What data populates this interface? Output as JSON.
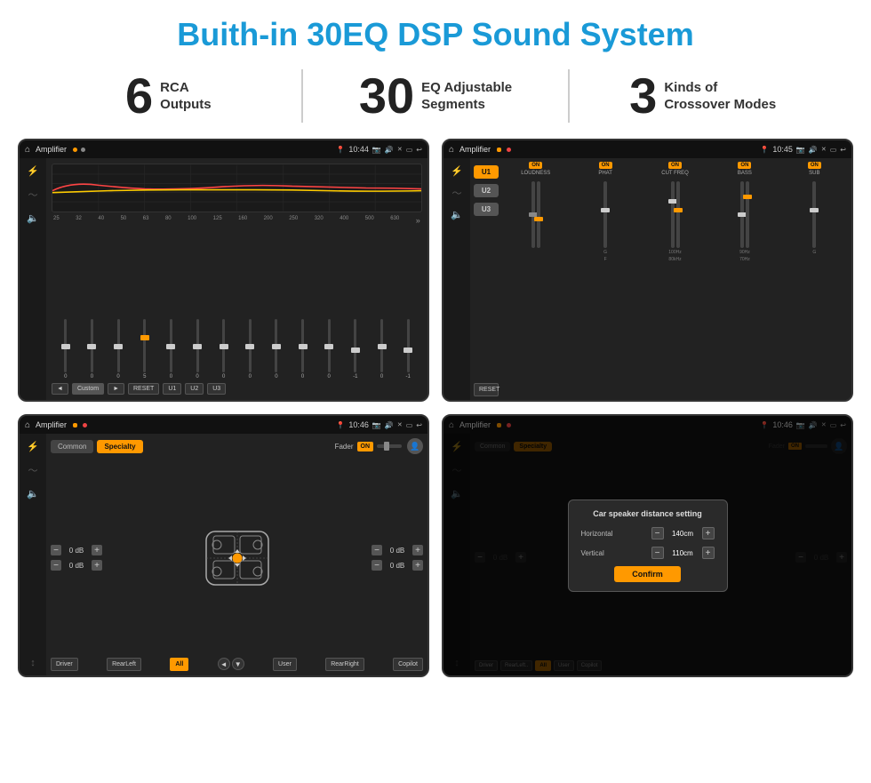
{
  "page": {
    "title": "Buith-in 30EQ DSP Sound System",
    "stats": [
      {
        "number": "6",
        "text": "RCA\nOutputs"
      },
      {
        "number": "30",
        "text": "EQ Adjustable\nSegments"
      },
      {
        "number": "3",
        "text": "Kinds of\nCrossover Modes"
      }
    ]
  },
  "screens": {
    "eq": {
      "title": "Amplifier",
      "time": "10:44",
      "freq_labels": [
        "25",
        "32",
        "40",
        "50",
        "63",
        "80",
        "100",
        "125",
        "160",
        "200",
        "250",
        "320",
        "400",
        "500",
        "630"
      ],
      "slider_values": [
        "0",
        "0",
        "0",
        "5",
        "0",
        "0",
        "0",
        "0",
        "0",
        "0",
        "0",
        "-1",
        "0",
        "-1"
      ],
      "controls": [
        "◄",
        "Custom",
        "►",
        "RESET",
        "U1",
        "U2",
        "U3"
      ]
    },
    "crossover": {
      "title": "Amplifier",
      "time": "10:45",
      "presets": [
        "U1",
        "U2",
        "U3"
      ],
      "channels": [
        {
          "label": "LOUDNESS",
          "on": true
        },
        {
          "label": "PHAT",
          "on": true
        },
        {
          "label": "CUT FREQ",
          "on": true
        },
        {
          "label": "BASS",
          "on": true
        },
        {
          "label": "SUB",
          "on": true
        }
      ],
      "reset": "RESET"
    },
    "fader": {
      "title": "Amplifier",
      "time": "10:46",
      "tabs": [
        "Common",
        "Specialty"
      ],
      "fader_label": "Fader",
      "on": "ON",
      "volumes": [
        {
          "value": "0 dB"
        },
        {
          "value": "0 dB"
        },
        {
          "value": "0 dB"
        },
        {
          "value": "0 dB"
        }
      ],
      "buttons": [
        "Driver",
        "RearLeft",
        "All",
        "User",
        "RearRight",
        "Copilot"
      ]
    },
    "distance": {
      "title": "Amplifier",
      "time": "10:46",
      "dialog": {
        "title": "Car speaker distance setting",
        "horizontal_label": "Horizontal",
        "horizontal_value": "140cm",
        "vertical_label": "Vertical",
        "vertical_value": "110cm",
        "confirm_label": "Confirm"
      },
      "volumes": [
        {
          "value": "0 dB"
        },
        {
          "value": "0 dB"
        }
      ],
      "buttons": [
        "Driver",
        "RearLeft..",
        "All",
        "User",
        "Copilot"
      ]
    }
  }
}
